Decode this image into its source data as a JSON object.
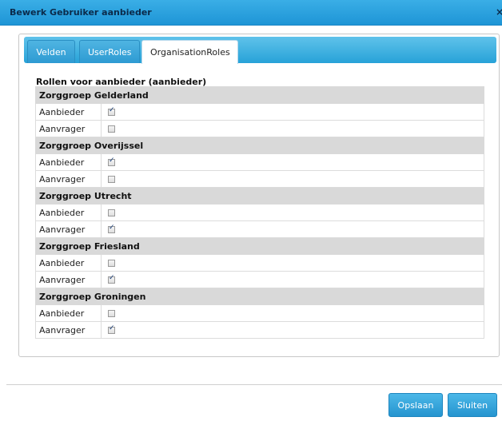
{
  "dialog": {
    "title": "Bewerk Gebruiker aanbieder",
    "close_glyph": "×"
  },
  "tabs": [
    {
      "label": "Velden",
      "active": false
    },
    {
      "label": "UserRoles",
      "active": false
    },
    {
      "label": "OrganisationRoles",
      "active": true
    }
  ],
  "roles_heading": "Rollen voor aanbieder (aanbieder)",
  "groups": [
    {
      "name": "Zorggroep Gelderland",
      "roles": [
        {
          "label": "Aanbieder",
          "checked": true
        },
        {
          "label": "Aanvrager",
          "checked": false
        }
      ]
    },
    {
      "name": "Zorggroep Overijssel",
      "roles": [
        {
          "label": "Aanbieder",
          "checked": true
        },
        {
          "label": "Aanvrager",
          "checked": false
        }
      ]
    },
    {
      "name": "Zorggroep Utrecht",
      "roles": [
        {
          "label": "Aanbieder",
          "checked": false
        },
        {
          "label": "Aanvrager",
          "checked": true
        }
      ]
    },
    {
      "name": "Zorggroep Friesland",
      "roles": [
        {
          "label": "Aanbieder",
          "checked": false
        },
        {
          "label": "Aanvrager",
          "checked": true
        }
      ]
    },
    {
      "name": "Zorggroep Groningen",
      "roles": [
        {
          "label": "Aanbieder",
          "checked": false
        },
        {
          "label": "Aanvrager",
          "checked": true
        }
      ]
    }
  ],
  "buttons": {
    "save": "Opslaan",
    "close": "Sluiten"
  },
  "colors": {
    "accent": "#27a2d8",
    "group_header_bg": "#d9d9d9"
  }
}
